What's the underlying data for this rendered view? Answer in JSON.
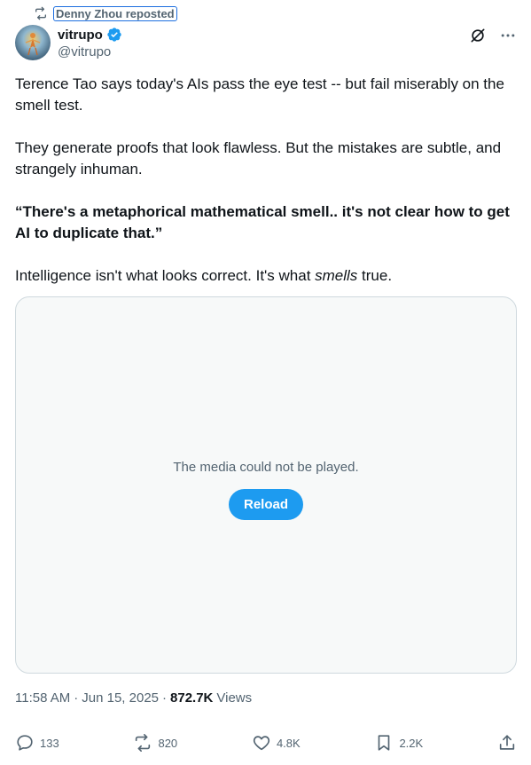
{
  "repost": {
    "label": "Denny Zhou reposted"
  },
  "author": {
    "display_name": "vitrupo",
    "handle": "@vitrupo",
    "verified": true
  },
  "tweet": {
    "paragraph_1": "Terence Tao says today's AIs pass the eye test -- but fail miserably on the smell test.",
    "paragraph_2": "They generate proofs that look flawless. But the mistakes are subtle, and strangely inhuman.",
    "quote": "“There's a metaphorical mathematical smell.. it's not clear how to get AI to duplicate that.”",
    "paragraph_4_pre": "Intelligence isn't what looks correct. It's what ",
    "paragraph_4_em": "smells",
    "paragraph_4_post": " true."
  },
  "media": {
    "message": "The media could not be played.",
    "reload_label": "Reload"
  },
  "meta": {
    "time": "11:58 AM",
    "separator": "·",
    "date": "Jun 15, 2025",
    "views_count": "872.7K",
    "views_label": "Views"
  },
  "actions": {
    "replies": "133",
    "reposts": "820",
    "likes": "4.8K",
    "bookmarks": "2.2K"
  },
  "colors": {
    "accent": "#1d9bf0",
    "secondary_text": "#536471",
    "primary_text": "#0f1419",
    "border": "#cfd9de",
    "media_bg": "#f7f9f9"
  }
}
